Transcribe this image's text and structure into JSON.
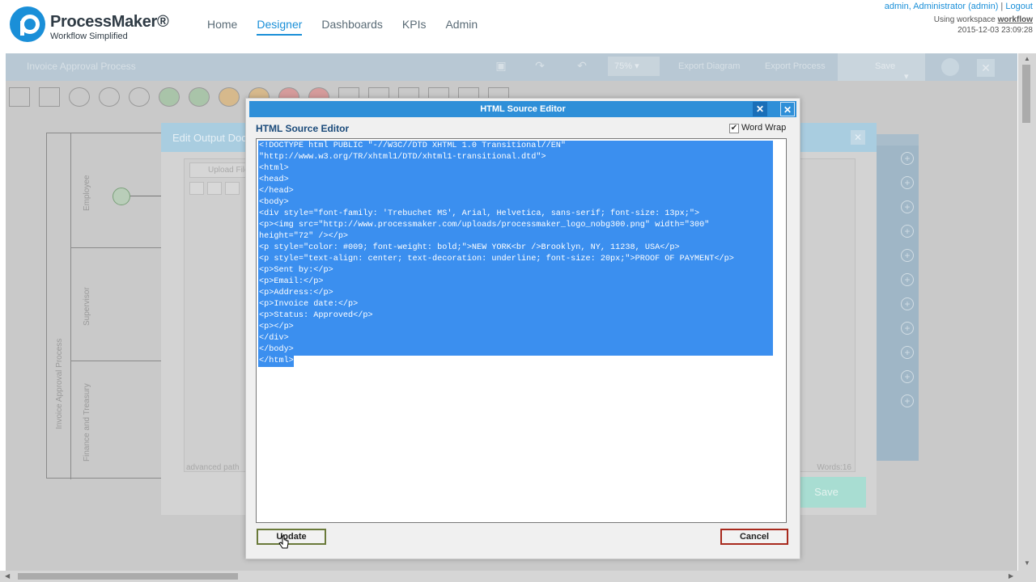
{
  "header": {
    "brand_name": "ProcessMaker®",
    "brand_tagline": "Workflow Simplified",
    "nav": [
      "Home",
      "Designer",
      "Dashboards",
      "KPIs",
      "Admin"
    ],
    "active_nav": "Designer",
    "user": "admin, Administrator (admin)",
    "separator": "|",
    "logout": "Logout",
    "workspace_prefix": "Using workspace",
    "workspace_name": "workflow",
    "datetime": "2015-12-03 23:09:28"
  },
  "designer": {
    "process_title": "Invoice Approval Process",
    "zoom": "75%",
    "export_diagram": "Export Diagram",
    "export_process": "Export Process",
    "save": "Save",
    "pool_label": "Invoice Approval Process",
    "lanes": [
      "Employee",
      "Supervisor",
      "Finance and Treasury"
    ]
  },
  "output_dialog": {
    "title": "Edit Output Doc",
    "upload_file": "Upload File",
    "advanced_path": "advanced path",
    "words": "Words:16",
    "save": "Save"
  },
  "editor": {
    "window_title": "HTML Source Editor",
    "heading": "HTML Source Editor",
    "word_wrap_label": "Word Wrap",
    "word_wrap_checked": "✔",
    "code_lines": [
      "<!DOCTYPE html PUBLIC \"-//W3C//DTD XHTML 1.0 Transitional//EN\"",
      "\"http://www.w3.org/TR/xhtml1/DTD/xhtml1-transitional.dtd\">",
      "<html>",
      "<head>",
      "</head>",
      "<body>",
      "<div style=\"font-family: 'Trebuchet MS', Arial, Helvetica, sans-serif; font-size: 13px;\">",
      "<p><img src=\"http://www.processmaker.com/uploads/processmaker_logo_nobg300.png\" width=\"300\"",
      "height=\"72\" /></p>",
      "<p style=\"color: #009; font-weight: bold;\">NEW YORK<br />Brooklyn, NY, 11238, USA</p>",
      "<p style=\"text-align: center; text-decoration: underline; font-size: 20px;\">PROOF OF PAYMENT</p>",
      "<p>Sent by:</p>",
      "<p>Email:</p>",
      "<p>Address:</p>",
      "<p>Invoice date:</p>",
      "<p>Status: Approved</p>",
      "<p></p>",
      "</div>",
      "</body>",
      "</html>"
    ],
    "update": "Update",
    "cancel": "Cancel"
  }
}
